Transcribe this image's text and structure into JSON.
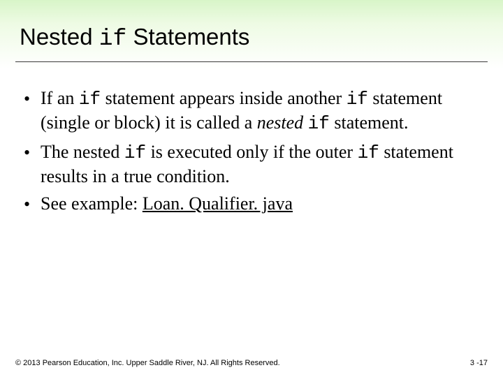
{
  "title": {
    "pre": "Nested ",
    "code": "if",
    "post": " Statements"
  },
  "bullets": [
    {
      "seg1": "If an ",
      "code1": "if",
      "seg2": " statement appears inside another ",
      "code2": "if",
      "seg3": " statement (single or block) it is called a ",
      "italic": "nested",
      "seg4": " ",
      "code3": "if",
      "seg5": " statement."
    },
    {
      "seg1": "The nested ",
      "code1": "if",
      "seg2": " is executed only if the outer ",
      "code2": "if",
      "seg3": " statement results in a true condition."
    },
    {
      "seg1": "See example: ",
      "link": "Loan. Qualifier. java"
    }
  ],
  "footer": {
    "copyright": "© 2013 Pearson Education, Inc. Upper Saddle River, NJ. All Rights Reserved.",
    "page": "3 -17"
  }
}
